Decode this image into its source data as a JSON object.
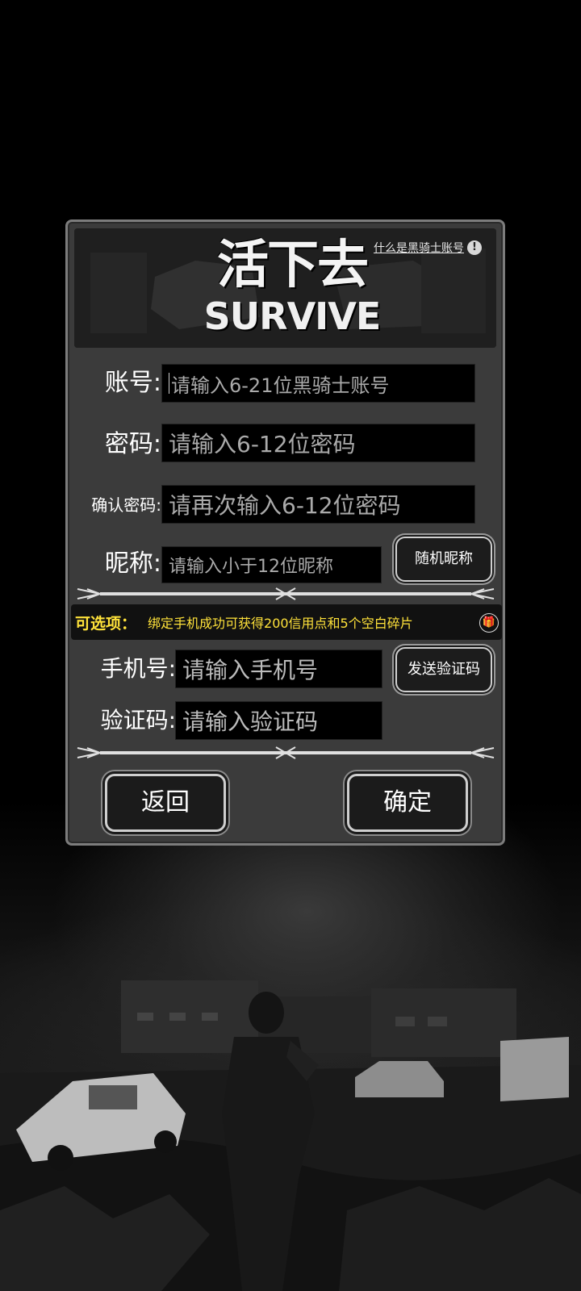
{
  "game": {
    "logo_cn": "活下去",
    "logo_en": "SURVIVE",
    "what_is_account": "什么是黑骑士账号",
    "info_icon": "exclamation-icon"
  },
  "form": {
    "account": {
      "label": "账号:",
      "placeholder": "请输入6-21位黑骑士账号"
    },
    "password": {
      "label": "密码:",
      "placeholder": "请输入6-12位密码"
    },
    "confirm_password": {
      "label": "确认密码:",
      "placeholder": "请再次输入6-12位密码"
    },
    "nickname": {
      "label": "昵称:",
      "placeholder": "请输入小于12位昵称"
    },
    "random_nickname_button": "随机昵称"
  },
  "optional": {
    "title": "可选项：",
    "text": "绑定手机成功可获得200信用点和5个空白碎片",
    "icon": "gift-icon"
  },
  "phone": {
    "label": "手机号:",
    "placeholder": "请输入手机号",
    "send_code_button": "发送验证码"
  },
  "code": {
    "label": "验证码:",
    "placeholder": "请输入验证码"
  },
  "buttons": {
    "back": "返回",
    "confirm": "确定"
  },
  "colors": {
    "accent_yellow": "#ffe23a",
    "panel": "#3b3b3b"
  }
}
